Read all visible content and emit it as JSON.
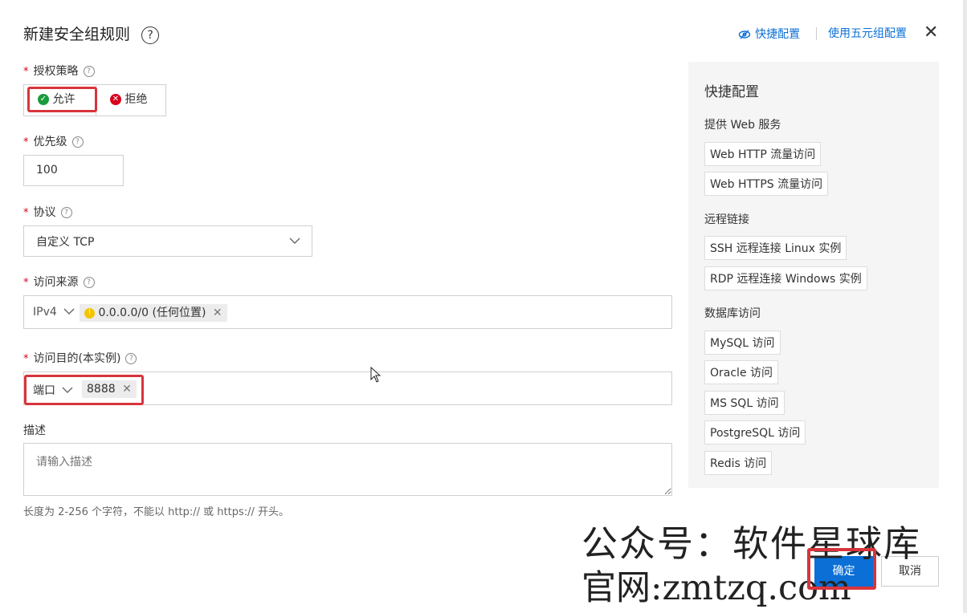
{
  "dialog": {
    "title": "新建安全组规则",
    "help_glyph": "?",
    "quick_config_link": "快捷配置",
    "five_tuple_link": "使用五元组配置",
    "close_glyph": "✕"
  },
  "form": {
    "policy": {
      "label": "授权策略",
      "options": [
        "允许",
        "拒绝"
      ],
      "selected": "允许"
    },
    "priority": {
      "label": "优先级",
      "value": "100"
    },
    "protocol": {
      "label": "协议",
      "value": "自定义 TCP"
    },
    "source": {
      "label": "访问来源",
      "type": "IPv4",
      "tag": "0.0.0.0/0 (任何位置)"
    },
    "destination": {
      "label": "访问目的(本实例)",
      "type": "端口",
      "tag": "8888"
    },
    "description": {
      "label": "描述",
      "placeholder": "请输入描述",
      "hint": "长度为 2-256 个字符，不能以 http:// 或 https:// 开头。"
    }
  },
  "quick_panel": {
    "title": "快捷配置",
    "groups": [
      {
        "title": "提供 Web 服务",
        "items": [
          "Web HTTP 流量访问",
          "Web HTTPS 流量访问"
        ]
      },
      {
        "title": "远程链接",
        "items": [
          "SSH 远程连接 Linux 实例",
          "RDP 远程连接 Windows 实例"
        ]
      },
      {
        "title": "数据库访问",
        "items": [
          "MySQL 访问",
          "Oracle 访问",
          "MS SQL 访问",
          "PostgreSQL 访问",
          "Redis 访问"
        ]
      }
    ]
  },
  "footer": {
    "confirm": "确定",
    "cancel": "取消"
  },
  "watermark": {
    "line1": "公众号：软件星球库",
    "line2": "官网:zmtzq.com"
  },
  "colors": {
    "accent": "#0b6fd6",
    "required": "#d9001b",
    "highlight_frame": "#d8343b",
    "allow_icon": "#1a9b3d",
    "deny_icon": "#d9001b",
    "panel_bg": "#f5f5f6"
  }
}
